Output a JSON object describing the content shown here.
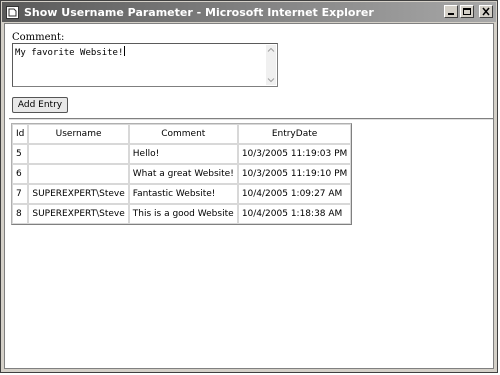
{
  "window": {
    "title": "Show Username Parameter - Microsoft Internet Explorer"
  },
  "form": {
    "comment_label": "Comment:",
    "comment_value": "My favorite Website!",
    "add_button_label": "Add Entry"
  },
  "table": {
    "headers": [
      "Id",
      "Username",
      "Comment",
      "EntryDate"
    ],
    "rows": [
      [
        "5",
        "",
        "Hello!",
        "10/3/2005 11:19:03 PM"
      ],
      [
        "6",
        "",
        "What a great Website!",
        "10/3/2005 11:19:10 PM"
      ],
      [
        "7",
        "SUPEREXPERT\\Steve",
        "Fantastic Website!",
        "10/4/2005 1:09:27 AM"
      ],
      [
        "8",
        "SUPEREXPERT\\Steve",
        "This is a good Website",
        "10/4/2005 1:18:38 AM"
      ]
    ]
  },
  "icons": {
    "window_icon": "ie-page-icon",
    "minimize": "minimize-icon",
    "maximize": "maximize-icon",
    "close": "close-icon",
    "scroll_up": "scroll-up-arrow-icon",
    "scroll_down": "scroll-down-arrow-icon"
  }
}
